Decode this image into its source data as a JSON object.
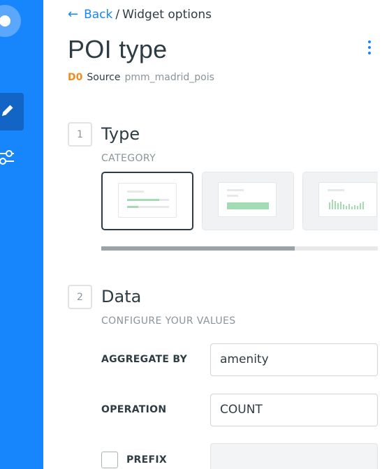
{
  "breadcrumb": {
    "back_label": "Back",
    "separator": "/",
    "current": "Widget options"
  },
  "title": "POI type",
  "source": {
    "id": "D0",
    "label": "Source",
    "name": "pmm_madrid_pois"
  },
  "steps": [
    {
      "number": "1",
      "title": "Type",
      "subtitle": "CATEGORY"
    },
    {
      "number": "2",
      "title": "Data",
      "subtitle": "CONFIGURE YOUR VALUES"
    }
  ],
  "type_options": [
    {
      "icon": "category-bars-icon",
      "selected": true
    },
    {
      "icon": "formula-bar-icon",
      "selected": false
    },
    {
      "icon": "histogram-icon",
      "selected": false
    }
  ],
  "scroll_progress": 0.7,
  "fields": {
    "aggregate_by": {
      "label": "AGGREGATE BY",
      "value": "amenity"
    },
    "operation": {
      "label": "OPERATION",
      "value": "COUNT"
    },
    "prefix": {
      "label": "PREFIX",
      "value": "",
      "checked": false
    }
  },
  "colors": {
    "accent": "#1785fb",
    "rail": "#1785fb",
    "source_id": "#f28c20",
    "chart_green": "#a3dcb3"
  }
}
